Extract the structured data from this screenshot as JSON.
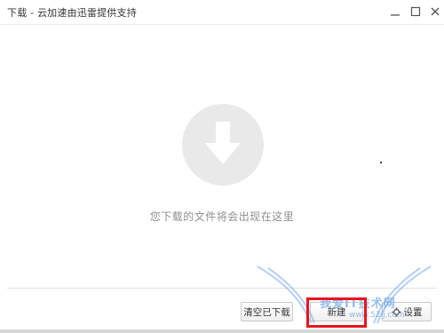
{
  "window": {
    "title": "下载 - 云加速由迅雷提供支持"
  },
  "empty_state": {
    "icon": "download-arrow-icon",
    "message": "您下载的文件将会出现在这里"
  },
  "footer": {
    "clear_label": "清空已下载",
    "new_label": "新建",
    "settings_label": "设置"
  },
  "watermark": {
    "text": "我爱IT技术网",
    "url": "www.52ij.com"
  },
  "colors": {
    "highlight": "#e8141e",
    "circle": "#e9e9e9",
    "text_muted": "#8f8f8f"
  }
}
